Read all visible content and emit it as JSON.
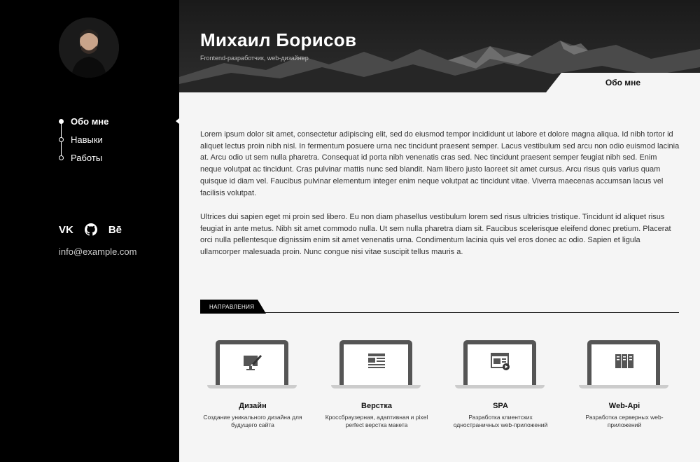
{
  "header": {
    "name": "Михаил Борисов",
    "role": "Frontend-разработчик, web-дизайнер",
    "active_tab": "Обо мне"
  },
  "sidebar": {
    "nav": [
      {
        "label": "Обо мне",
        "active": true
      },
      {
        "label": "Навыки",
        "active": false
      },
      {
        "label": "Работы",
        "active": false
      }
    ],
    "socials": [
      {
        "icon": "vk-icon",
        "label": "VK"
      },
      {
        "icon": "github-icon",
        "label": ""
      },
      {
        "icon": "behance-icon",
        "label": "Bē"
      }
    ],
    "email": "info@example.com"
  },
  "main": {
    "paragraphs": [
      "Lorem ipsum dolor sit amet, consectetur adipiscing elit, sed do eiusmod tempor incididunt ut labore et dolore magna aliqua. Id nibh tortor id aliquet lectus proin nibh nisl. In fermentum posuere urna nec tincidunt praesent semper. Lacus vestibulum sed arcu non odio euismod lacinia at. Arcu odio ut sem nulla pharetra. Consequat id porta nibh venenatis cras sed. Nec tincidunt praesent semper feugiat nibh sed. Enim neque volutpat ac tincidunt. Cras pulvinar mattis nunc sed blandit. Nam libero justo laoreet sit amet cursus. Arcu risus quis varius quam quisque id diam vel. Faucibus pulvinar elementum integer enim neque volutpat ac tincidunt vitae. Viverra maecenas accumsan lacus vel facilisis volutpat.",
      "Ultrices dui sapien eget mi proin sed libero. Eu non diam phasellus vestibulum lorem sed risus ultricies tristique. Tincidunt id aliquet risus feugiat in ante metus. Nibh sit amet commodo nulla. Ut sem nulla pharetra diam sit. Faucibus scelerisque eleifend donec pretium. Placerat orci nulla pellentesque dignissim enim sit amet venenatis urna. Condimentum lacinia quis vel eros donec ac odio. Sapien et ligula ullamcorper malesuada proin. Nunc congue nisi vitae suscipit tellus mauris a."
    ],
    "section_label": "НАПРАВЛЕНИЯ",
    "services": [
      {
        "icon": "design-icon",
        "title": "Дизайн",
        "desc": "Создание уникального дизайна для будущего сайта"
      },
      {
        "icon": "layout-icon",
        "title": "Верстка",
        "desc": "Кроссбраузерная, адаптивная и pixel perfect верстка макета"
      },
      {
        "icon": "spa-icon",
        "title": "SPA",
        "desc": "Разработка клиентских одностраничных web-приложений"
      },
      {
        "icon": "server-icon",
        "title": "Web-Api",
        "desc": "Разработка серверных web-приложений"
      }
    ]
  }
}
